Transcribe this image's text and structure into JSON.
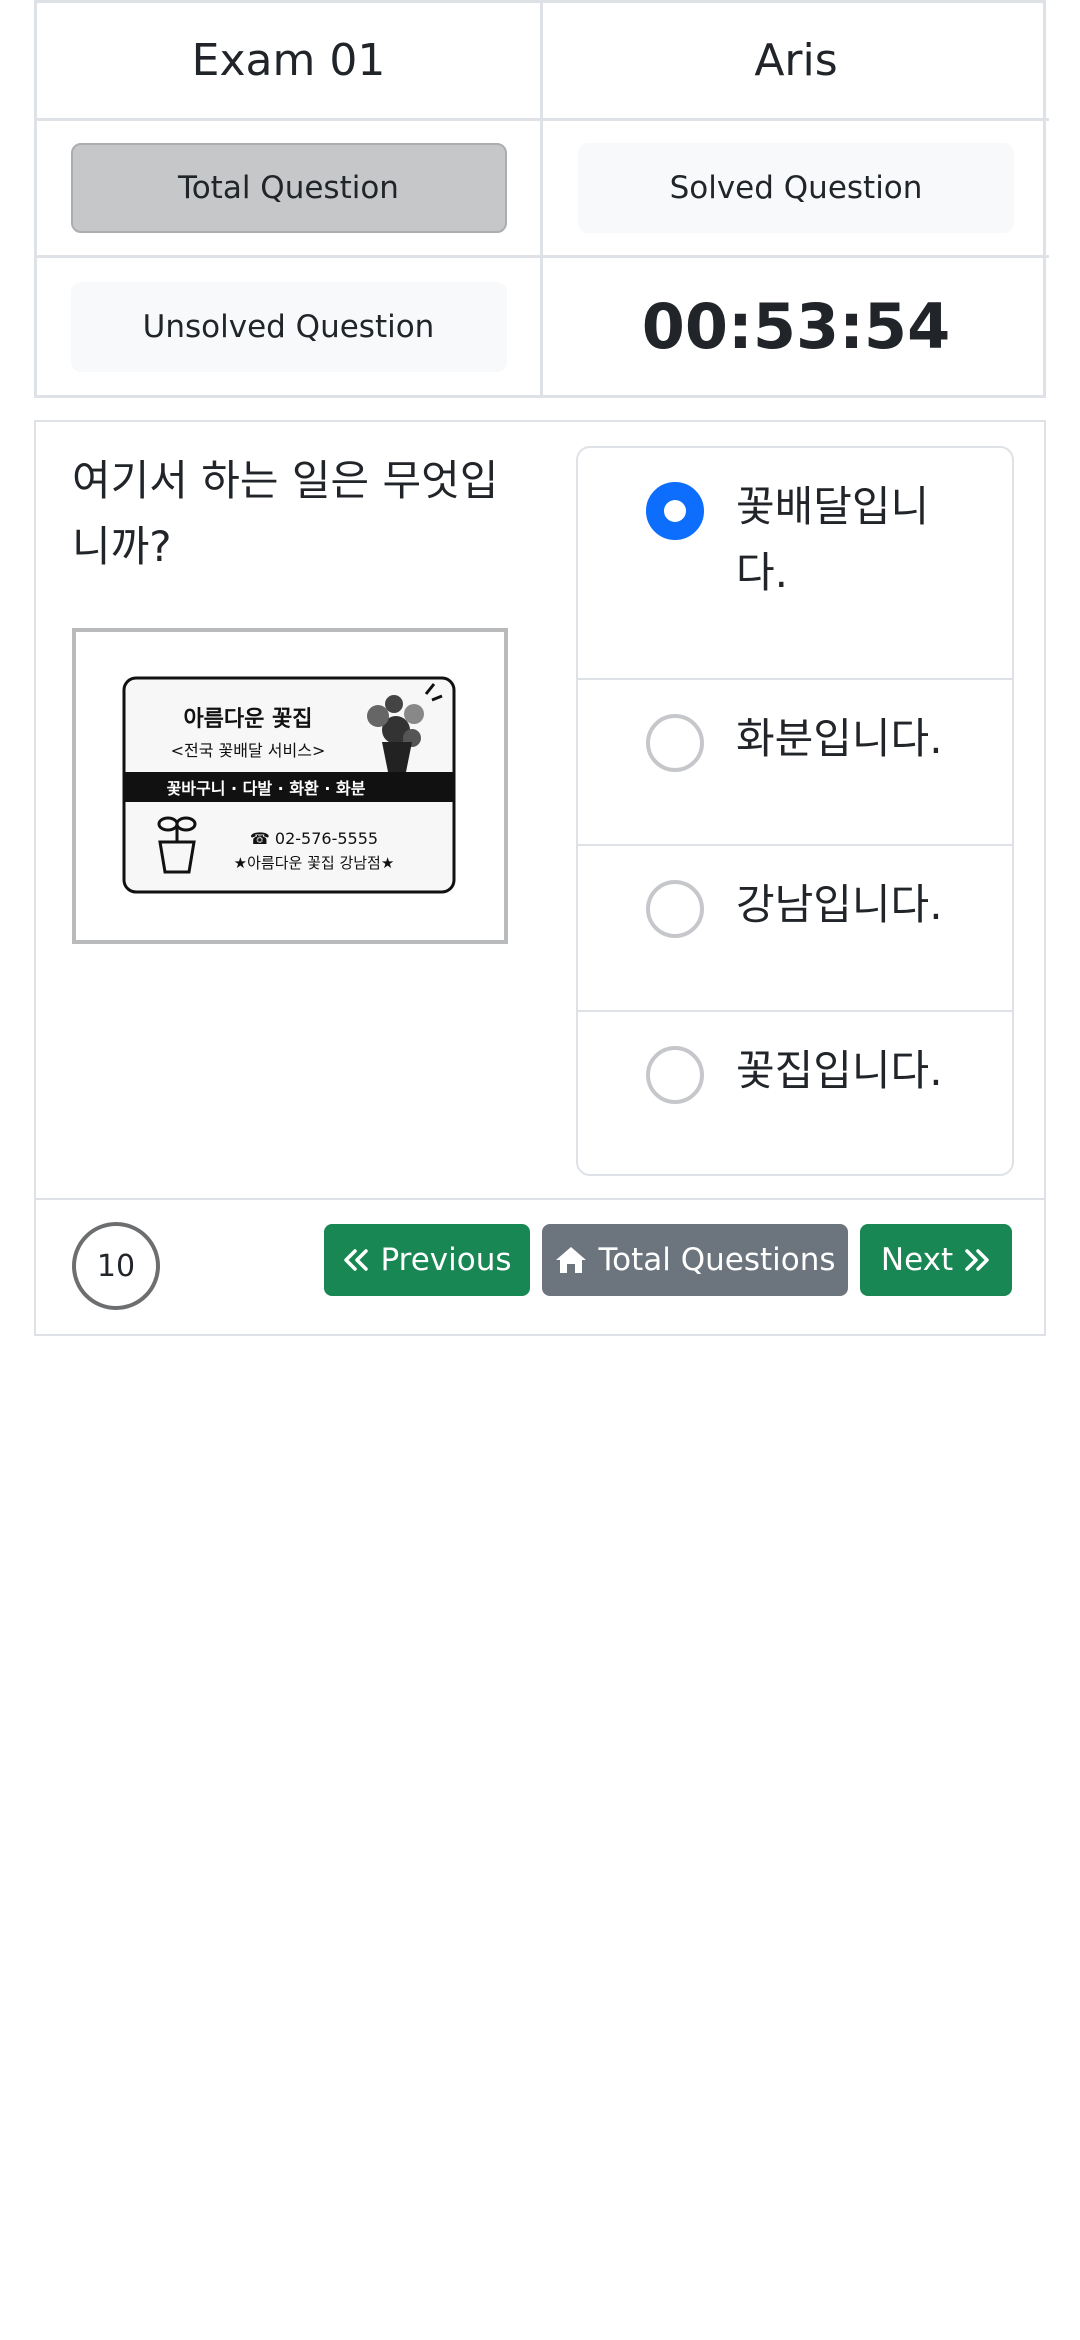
{
  "header": {
    "exam_name": "Exam 01",
    "user_name": "Aris",
    "total_question_label": "Total Question",
    "solved_question_label": "Solved Question",
    "unsolved_question_label": "Unsolved Question",
    "timer": "00:53:54"
  },
  "question": {
    "text": "여기서 하는 일은 무엇입니까?",
    "number": "10",
    "image": {
      "shop_name": "아름다운 꽃집",
      "service": "<전국 꽃배달 서비스>",
      "items": "꽃바구니 · 다발 · 화환 · 화분",
      "phone": "☎ 02-576-5555",
      "branch": "★아름다운 꽃집 강남점★"
    },
    "options": [
      {
        "label": "꽃배달입니다.",
        "selected": true
      },
      {
        "label": "화분입니다.",
        "selected": false
      },
      {
        "label": "강남입니다.",
        "selected": false
      },
      {
        "label": "꽃집입니다.",
        "selected": false
      }
    ]
  },
  "nav": {
    "previous_label": "Previous",
    "total_questions_label": "Total Questions",
    "next_label": "Next"
  },
  "colors": {
    "primary": "#0d6efd",
    "success": "#198754",
    "secondary": "#6c757d",
    "border": "#dee2e6"
  },
  "icons": {
    "previous": "double-chevron-left-icon",
    "total": "home-icon",
    "next": "double-chevron-right-icon"
  }
}
